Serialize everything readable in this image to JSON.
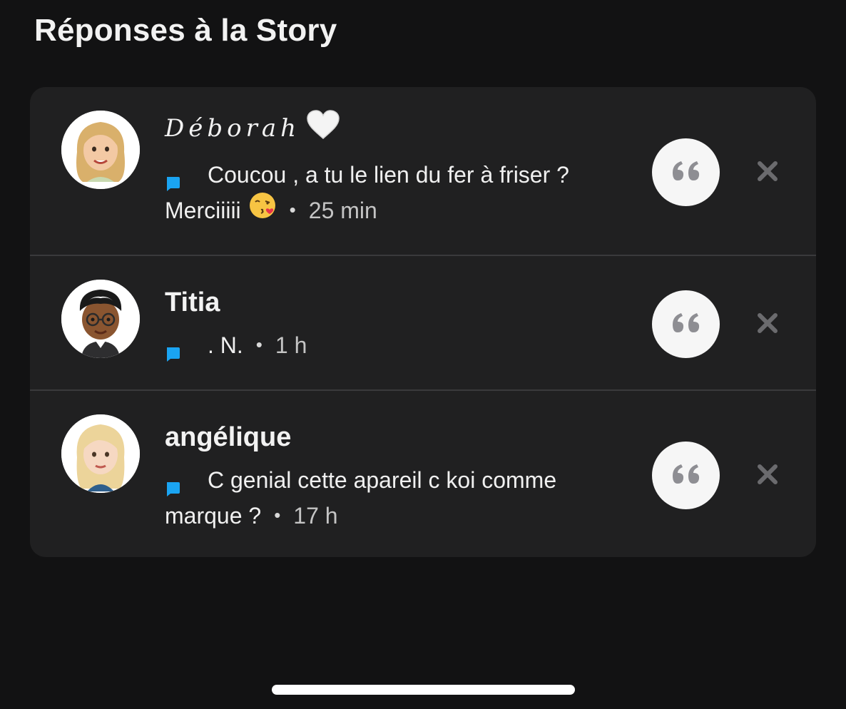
{
  "header": {
    "title": "Réponses à la Story"
  },
  "replies": [
    {
      "name": "Déborah",
      "name_suffix_icon": "white-heart-icon",
      "message": "Coucou , a tu le lien du fer à friser ? Merciiiii",
      "message_emoji": "kissing-face-icon",
      "time": "25 min",
      "avatar": "bitmoji-avatar-blonde"
    },
    {
      "name": "Titia",
      "message": ". N.",
      "time": "1 h",
      "avatar": "bitmoji-avatar-glasses"
    },
    {
      "name": "angélique",
      "message": "C genial cette apareil c koi comme marque ?",
      "time": "17 h",
      "avatar": "bitmoji-avatar-light-blonde"
    }
  ],
  "icons": {
    "message_type": "chat-bubble-icon",
    "reply": "quote-icon",
    "dismiss": "close-icon"
  },
  "colors": {
    "background": "#121213",
    "card": "#202021",
    "accent_blue": "#1aa4f2"
  }
}
